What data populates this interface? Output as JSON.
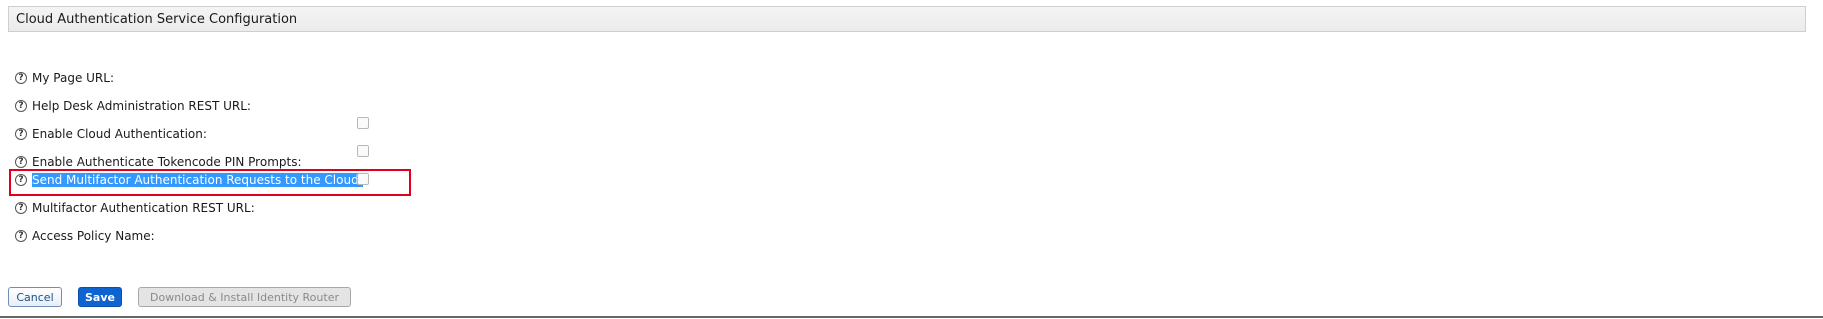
{
  "section": {
    "title": "Cloud Authentication Service Configuration"
  },
  "fields": [
    {
      "label": "My Page URL:",
      "help_icon": "question-mark-icon",
      "has_checkbox": false,
      "checked": false
    },
    {
      "label": "Help Desk Administration REST URL:",
      "help_icon": "question-mark-icon",
      "has_checkbox": false,
      "checked": false
    },
    {
      "label": "Enable Cloud Authentication:",
      "help_icon": "question-mark-icon",
      "has_checkbox": true,
      "checked": false
    },
    {
      "label": "Enable Authenticate Tokencode PIN Prompts:",
      "help_icon": "question-mark-icon",
      "has_checkbox": true,
      "checked": false
    },
    {
      "label": "Send Multifactor Authentication Requests to the Cloud:",
      "help_icon": "question-mark-icon",
      "has_checkbox": true,
      "checked": false,
      "selected_text": true,
      "highlighted": true
    },
    {
      "label": "Multifactor Authentication REST URL:",
      "help_icon": "question-mark-icon",
      "has_checkbox": false,
      "checked": false
    },
    {
      "label": "Access Policy Name:",
      "help_icon": "question-mark-icon",
      "has_checkbox": false,
      "checked": false
    }
  ],
  "help_icon_glyph": "?",
  "buttons": {
    "cancel": "Cancel",
    "save": "Save",
    "download": "Download & Install Identity Router"
  },
  "colors": {
    "highlight_border": "#e0001b",
    "selection_bg": "#3399ff",
    "save_bg": "#0d63cf"
  }
}
